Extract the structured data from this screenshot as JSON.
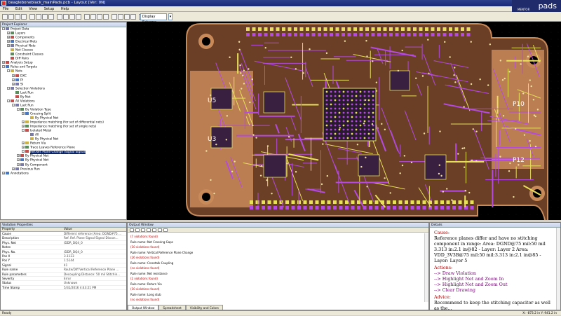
{
  "window": {
    "title": "beagleboneblack_mainPads.pcb - Layout [Ver: 0N]"
  },
  "menu": [
    "File",
    "Edit",
    "View",
    "Setup",
    "Help"
  ],
  "toolbar": {
    "display_scheme": "Display Scheme"
  },
  "logo": {
    "brand": "pads",
    "vendor": "MENTOR"
  },
  "project_explorer": {
    "title": "Project Explorer",
    "items": [
      {
        "label": "Project Data",
        "level": 0,
        "exp": "-"
      },
      {
        "label": "Layers",
        "level": 1,
        "exp": "+"
      },
      {
        "label": "Components",
        "level": 1,
        "exp": "+"
      },
      {
        "label": "Electrical Nets",
        "level": 1,
        "exp": "+"
      },
      {
        "label": "Physical Nets",
        "level": 1,
        "exp": "+"
      },
      {
        "label": "Net Classes",
        "level": 1,
        "exp": ""
      },
      {
        "label": "Constraint Classes",
        "level": 1,
        "exp": ""
      },
      {
        "label": "Diff Pairs",
        "level": 1,
        "exp": ""
      },
      {
        "label": "Analysis Setup",
        "level": 0,
        "exp": "+"
      },
      {
        "label": "Rules and Targets",
        "level": 0,
        "exp": "-"
      },
      {
        "label": "Nets",
        "level": 1,
        "exp": "-"
      },
      {
        "label": "DXC",
        "level": 2,
        "exp": "+"
      },
      {
        "label": "PI",
        "level": 2,
        "exp": "+"
      },
      {
        "label": "SI",
        "level": 2,
        "exp": "+"
      },
      {
        "label": "Selection Violations",
        "level": 1,
        "exp": "-"
      },
      {
        "label": "Last Run",
        "level": 2,
        "exp": ""
      },
      {
        "label": "By Net",
        "level": 2,
        "exp": ""
      },
      {
        "label": "All Violations",
        "level": 1,
        "exp": "-"
      },
      {
        "label": "Last Run",
        "level": 2,
        "exp": "-"
      },
      {
        "label": "By Violation Type",
        "level": 3,
        "exp": "-"
      },
      {
        "label": "Crossing Split",
        "level": 4,
        "exp": "+"
      },
      {
        "label": "By Physical Net",
        "level": 5,
        "exp": ""
      },
      {
        "label": "Impedance matching (for set of differential nets)",
        "level": 4,
        "exp": "+"
      },
      {
        "label": "Impedance matching (for set of single nets)",
        "level": 4,
        "exp": "+"
      },
      {
        "label": "Isolated Metal",
        "level": 4,
        "exp": "-"
      },
      {
        "label": "All",
        "level": 5,
        "exp": ""
      },
      {
        "label": "By Physical Net",
        "level": 5,
        "exp": ""
      },
      {
        "label": "Return Via",
        "level": 4,
        "exp": "+"
      },
      {
        "label": "Trace Leaves Reference Plane",
        "level": 4,
        "exp": "+"
      },
      {
        "label": "Ref.Ref. Plane Change (Signal Signal)",
        "level": 4,
        "exp": "-",
        "selected": true
      },
      {
        "label": "By Physical Net",
        "level": 3,
        "exp": "+"
      },
      {
        "label": "By Physical Net",
        "level": 3,
        "exp": "+"
      },
      {
        "label": "By Component",
        "level": 3,
        "exp": "+"
      },
      {
        "label": "Previous Run",
        "level": 2,
        "exp": "+"
      },
      {
        "label": "Annotations",
        "level": 0,
        "exp": "+"
      }
    ]
  },
  "violation_properties": {
    "title": "Violation Properties",
    "col_property": "Property",
    "col_value": "Value",
    "rows": [
      {
        "p": "Cause",
        "v": "Different reference (Area: DGND#75 ..."
      },
      {
        "p": "Description",
        "v": "Ref. Ref. Plane Signal Signal Discon..."
      },
      {
        "p": "Phys. Net",
        "v": "/DDR_DQ4_0"
      },
      {
        "p": "Notes",
        "v": ""
      },
      {
        "p": "Phys. No.",
        "v": "/DDR_DQ4_0"
      },
      {
        "p": "Pos X",
        "v": "3.1123"
      },
      {
        "p": "Pos Y",
        "v": "1.5144"
      },
      {
        "p": "Signal",
        "v": "41"
      },
      {
        "p": "Rule name",
        "v": "Route/Diff Vertical Reference Plane ..."
      },
      {
        "p": "Rule parameters",
        "v": "Decoupling Distance: 50 mil Stitchin..."
      },
      {
        "p": "Severity",
        "v": "Error"
      },
      {
        "p": "Status",
        "v": "Unknown"
      },
      {
        "p": "Time Stamp",
        "v": "5/31/2016 4:43:21 PM"
      }
    ]
  },
  "output_window": {
    "title": "Output Window",
    "lines": [
      {
        "t": "(7 violations found)",
        "red": true
      },
      {
        "t": "Rule name: Net Crossing Gaps",
        "red": false
      },
      {
        "t": "(10 violations found)",
        "red": true
      },
      {
        "t": "Rule name: Vertical Reference Plane Change",
        "red": false
      },
      {
        "t": "(26 violations found)",
        "red": true
      },
      {
        "t": "Rule name: Crosstalk Coupling",
        "red": false
      },
      {
        "t": "(no violations found)",
        "red": true
      },
      {
        "t": "Rule name: Net resistance",
        "red": false
      },
      {
        "t": "(2 violations found)",
        "red": true
      },
      {
        "t": "Rule name: Return Via",
        "red": false
      },
      {
        "t": "(10 violations found)",
        "red": true
      },
      {
        "t": "Rule name: Long stub",
        "red": false
      },
      {
        "t": "(no violations found)",
        "red": true
      },
      {
        "t": "Rule name: Via Stub Resonance_High",
        "red": false
      }
    ],
    "tabs": [
      "Output Window",
      "Spreadsheet",
      "Visibility and Colors"
    ]
  },
  "details": {
    "title": "Details",
    "cause_heading": "Cause:",
    "cause_text": "Reference planes differ and have no stitching component in range: Area: DGND@75 mil:50 mil 3.313 in:2.1 in@82 - Layer: Layer 2 Area: VDD_3V3B@75 mil:50 mil:3.313 in:2.1 in@85 - Layer: Layer 5",
    "actions_heading": "Actions:",
    "actions": [
      "--> Draw Violation",
      "--> Highlight Net and Zoom In",
      "--> Highlight Net and Zoom Out",
      "--> Clear Drawing"
    ],
    "advice_heading": "Advice:",
    "advice_text": "Recommend to keep the stitching capacitor as well as the..."
  },
  "pcb": {
    "silk": [
      "U5",
      "U3",
      "P10",
      "P12"
    ],
    "colors": {
      "board": "#c98a5a",
      "trace_purple": "#b44ae0",
      "trace_yellow": "#e8e05a",
      "bg": "#000000"
    }
  },
  "status": {
    "left": "Ready",
    "coords": "X: -873.2 in  Y: 941.2 in"
  }
}
